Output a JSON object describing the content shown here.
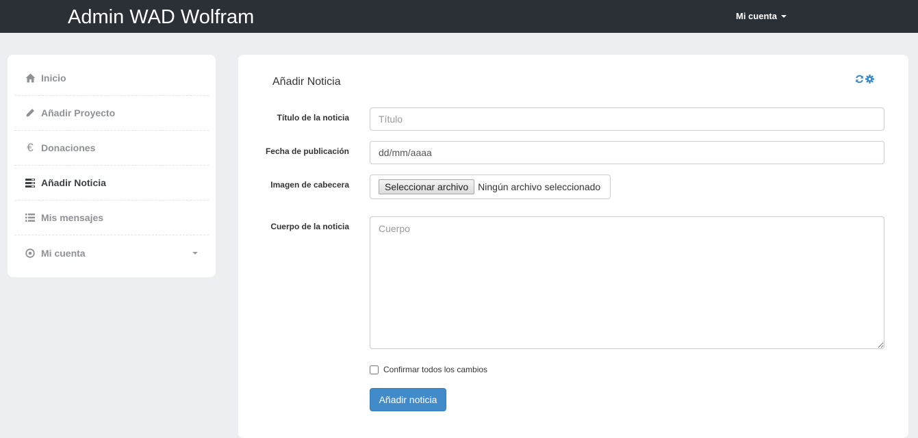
{
  "header": {
    "brand": "Admin WAD Wolfram",
    "account_label": "Mi cuenta"
  },
  "sidebar": {
    "items": [
      {
        "label": "Inicio",
        "icon": "home-icon"
      },
      {
        "label": "Añadir Proyecto",
        "icon": "pencil-icon"
      },
      {
        "label": "Donaciones",
        "icon": "euro-icon"
      },
      {
        "label": "Añadir Noticia",
        "icon": "tasks-icon",
        "active": true
      },
      {
        "label": "Mis mensajes",
        "icon": "list-icon"
      },
      {
        "label": "Mi cuenta",
        "icon": "record-icon"
      }
    ]
  },
  "panel": {
    "title": "Añadir Noticia",
    "tools": [
      "refresh-icon",
      "gear-icon"
    ]
  },
  "form": {
    "title_label": "Título de la noticia",
    "title_placeholder": "Título",
    "date_label": "Fecha de publicación",
    "date_value": "dd/mm/aaaa",
    "image_label": "Imagen de cabecera",
    "file_button": "Seleccionar archivo",
    "file_status": "Ningún archivo seleccionado",
    "body_label": "Cuerpo de la noticia",
    "body_placeholder": "Cuerpo",
    "confirm_label": "Confirmar todos los cambios",
    "submit_label": "Añadir noticia"
  },
  "colors": {
    "topbar": "#2b2f36",
    "primary": "#428bca",
    "icon_accent": "#3a87c8"
  }
}
